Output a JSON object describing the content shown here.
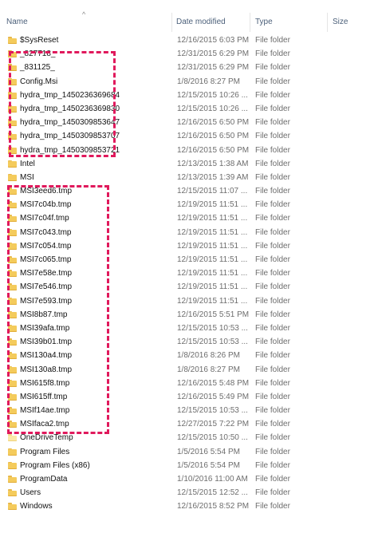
{
  "columns": {
    "name": "Name",
    "date": "Date modified",
    "type": "Type",
    "size": "Size"
  },
  "rows": [
    {
      "name": "$SysReset",
      "date": "12/16/2015 6:03 PM",
      "type": "File folder"
    },
    {
      "name": "_827718_",
      "date": "12/31/2015 6:29 PM",
      "type": "File folder"
    },
    {
      "name": "_831125_",
      "date": "12/31/2015 6:29 PM",
      "type": "File folder"
    },
    {
      "name": "Config.Msi",
      "date": "1/8/2016 8:27 PM",
      "type": "File folder"
    },
    {
      "name": "hydra_tmp_1450236369684",
      "date": "12/15/2015 10:26 ...",
      "type": "File folder"
    },
    {
      "name": "hydra_tmp_1450236369830",
      "date": "12/15/2015 10:26 ...",
      "type": "File folder"
    },
    {
      "name": "hydra_tmp_1450309853647",
      "date": "12/16/2015 6:50 PM",
      "type": "File folder"
    },
    {
      "name": "hydra_tmp_1450309853707",
      "date": "12/16/2015 6:50 PM",
      "type": "File folder"
    },
    {
      "name": "hydra_tmp_1450309853721",
      "date": "12/16/2015 6:50 PM",
      "type": "File folder"
    },
    {
      "name": "Intel",
      "date": "12/13/2015 1:38 AM",
      "type": "File folder"
    },
    {
      "name": "MSI",
      "date": "12/13/2015 1:39 AM",
      "type": "File folder"
    },
    {
      "name": "MSI3eed6.tmp",
      "date": "12/15/2015 11:07 ...",
      "type": "File folder"
    },
    {
      "name": "MSI7c04b.tmp",
      "date": "12/19/2015 11:51 ...",
      "type": "File folder"
    },
    {
      "name": "MSI7c04f.tmp",
      "date": "12/19/2015 11:51 ...",
      "type": "File folder"
    },
    {
      "name": "MSI7c043.tmp",
      "date": "12/19/2015 11:51 ...",
      "type": "File folder"
    },
    {
      "name": "MSI7c054.tmp",
      "date": "12/19/2015 11:51 ...",
      "type": "File folder"
    },
    {
      "name": "MSI7c065.tmp",
      "date": "12/19/2015 11:51 ...",
      "type": "File folder"
    },
    {
      "name": "MSI7e58e.tmp",
      "date": "12/19/2015 11:51 ...",
      "type": "File folder"
    },
    {
      "name": "MSI7e546.tmp",
      "date": "12/19/2015 11:51 ...",
      "type": "File folder"
    },
    {
      "name": "MSI7e593.tmp",
      "date": "12/19/2015 11:51 ...",
      "type": "File folder"
    },
    {
      "name": "MSI8b87.tmp",
      "date": "12/16/2015 5:51 PM",
      "type": "File folder"
    },
    {
      "name": "MSI39afa.tmp",
      "date": "12/15/2015 10:53 ...",
      "type": "File folder"
    },
    {
      "name": "MSI39b01.tmp",
      "date": "12/15/2015 10:53 ...",
      "type": "File folder"
    },
    {
      "name": "MSI130a4.tmp",
      "date": "1/8/2016 8:26 PM",
      "type": "File folder"
    },
    {
      "name": "MSI130a8.tmp",
      "date": "1/8/2016 8:27 PM",
      "type": "File folder"
    },
    {
      "name": "MSI615f8.tmp",
      "date": "12/16/2015 5:48 PM",
      "type": "File folder"
    },
    {
      "name": "MSI615ff.tmp",
      "date": "12/16/2015 5:49 PM",
      "type": "File folder"
    },
    {
      "name": "MSIf14ae.tmp",
      "date": "12/15/2015 10:53 ...",
      "type": "File folder"
    },
    {
      "name": "MSIfaca2.tmp",
      "date": "12/27/2015 7:22 PM",
      "type": "File folder"
    },
    {
      "name": "OneDriveTemp",
      "date": "12/15/2015 10:50 ...",
      "type": "File folder"
    },
    {
      "name": "Program Files",
      "date": "1/5/2016 5:54 PM",
      "type": "File folder"
    },
    {
      "name": "Program Files (x86)",
      "date": "1/5/2016 5:54 PM",
      "type": "File folder"
    },
    {
      "name": "ProgramData",
      "date": "1/10/2016 11:00 AM",
      "type": "File folder"
    },
    {
      "name": "Users",
      "date": "12/15/2015 12:52 ...",
      "type": "File folder"
    },
    {
      "name": "Windows",
      "date": "12/16/2015 8:52 PM",
      "type": "File folder"
    }
  ],
  "colors": {
    "highlight": "#e0195c",
    "folder": "#f4cb5c"
  }
}
